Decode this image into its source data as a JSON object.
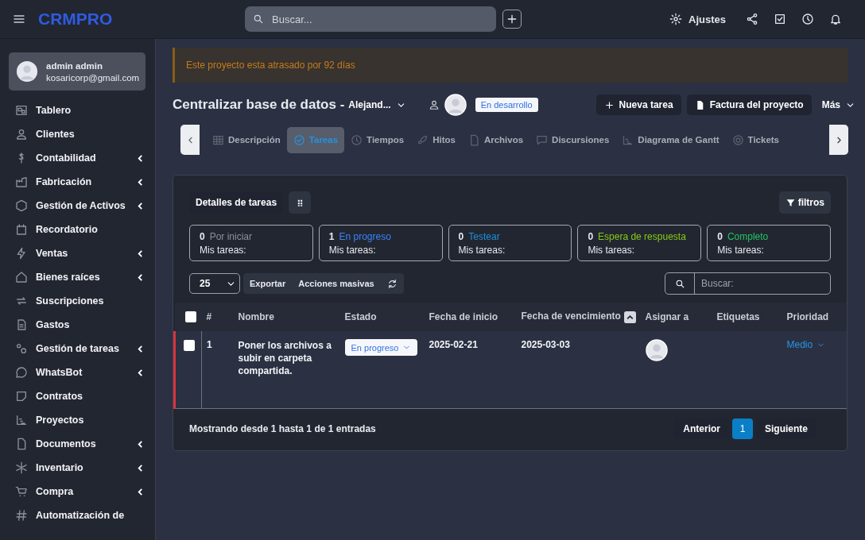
{
  "brand": "CRMPRO",
  "search": {
    "placeholder": "Buscar..."
  },
  "topbar": {
    "settings_label": "Ajustes"
  },
  "user": {
    "name": "admin admin",
    "email": "kosaricorp@gmail.com"
  },
  "sidebar": {
    "items": [
      {
        "label": "Tablero",
        "has_submenu": false
      },
      {
        "label": "Clientes",
        "has_submenu": false
      },
      {
        "label": "Contabilidad",
        "has_submenu": true
      },
      {
        "label": "Fabricación",
        "has_submenu": true
      },
      {
        "label": "Gestión de Activos",
        "has_submenu": true
      },
      {
        "label": "Recordatorio",
        "has_submenu": false
      },
      {
        "label": "Ventas",
        "has_submenu": true
      },
      {
        "label": "Bienes raíces",
        "has_submenu": true
      },
      {
        "label": "Suscripciones",
        "has_submenu": false
      },
      {
        "label": "Gastos",
        "has_submenu": false
      },
      {
        "label": "Gestión de tareas",
        "has_submenu": true
      },
      {
        "label": "WhatsBot",
        "has_submenu": true
      },
      {
        "label": "Contratos",
        "has_submenu": false
      },
      {
        "label": "Proyectos",
        "has_submenu": false
      },
      {
        "label": "Documentos",
        "has_submenu": true
      },
      {
        "label": "Inventario",
        "has_submenu": true
      },
      {
        "label": "Compra",
        "has_submenu": true
      },
      {
        "label": "Automatización de",
        "has_submenu": false
      }
    ]
  },
  "alert": "Este proyecto esta atrasado por 92 días",
  "project": {
    "title": "Centralizar base de datos -",
    "client": "Alejand...",
    "status": "En desarrollo"
  },
  "actions": [
    "Nueva tarea",
    "Factura del proyecto",
    "Más"
  ],
  "tabs": [
    {
      "label": "Descripción",
      "selected": false
    },
    {
      "label": "Tareas",
      "selected": true
    },
    {
      "label": "Tiempos",
      "selected": false
    },
    {
      "label": "Hitos",
      "selected": false
    },
    {
      "label": "Archivos",
      "selected": false
    },
    {
      "label": "Discursiones",
      "selected": false
    },
    {
      "label": "Diagrama de Gantt",
      "selected": false
    },
    {
      "label": "Tickets",
      "selected": false
    }
  ],
  "panel": {
    "details_button": "Detalles de tareas",
    "filter_button": "filtros",
    "summary": [
      {
        "count": "0",
        "label": "Por iniciar",
        "color": "#8b9099",
        "sub": "Mis tareas:"
      },
      {
        "count": "1",
        "label": "En progreso",
        "color": "#3b82f6",
        "sub": "Mis tareas:"
      },
      {
        "count": "0",
        "label": "Testear",
        "color": "#1e90d6",
        "sub": "Mis tareas:"
      },
      {
        "count": "0",
        "label": "Espera de respuesta",
        "color": "#84cc16",
        "sub": "Mis tareas:"
      },
      {
        "count": "0",
        "label": "Completo",
        "color": "#22c55e",
        "sub": "Mis tareas:"
      }
    ],
    "page_size": "25",
    "export": "Exportar",
    "bulk": "Acciones masivas",
    "search_placeholder": "Buscar:"
  },
  "table": {
    "select_all_checked": false,
    "columns": [
      "#",
      "Nombre",
      "Estado",
      "Fecha de inicio",
      "Fecha de vencimiento",
      "Asignar a",
      "Etiquetas",
      "Prioridad"
    ],
    "rows": [
      {
        "checked": false,
        "flagged": true,
        "number": "1",
        "name": "Poner los archivos a subir en carpeta compartida.",
        "status": "En progreso",
        "start": "2025-02-21",
        "due": "2025-03-03",
        "priority": "Medio"
      }
    ]
  },
  "footer": {
    "info": "Mostrando desde 1 hasta 1 de 1 entradas",
    "prev": "Anterior",
    "pages": [
      {
        "label": "1",
        "selected": true
      }
    ],
    "next": "Siguiente"
  }
}
